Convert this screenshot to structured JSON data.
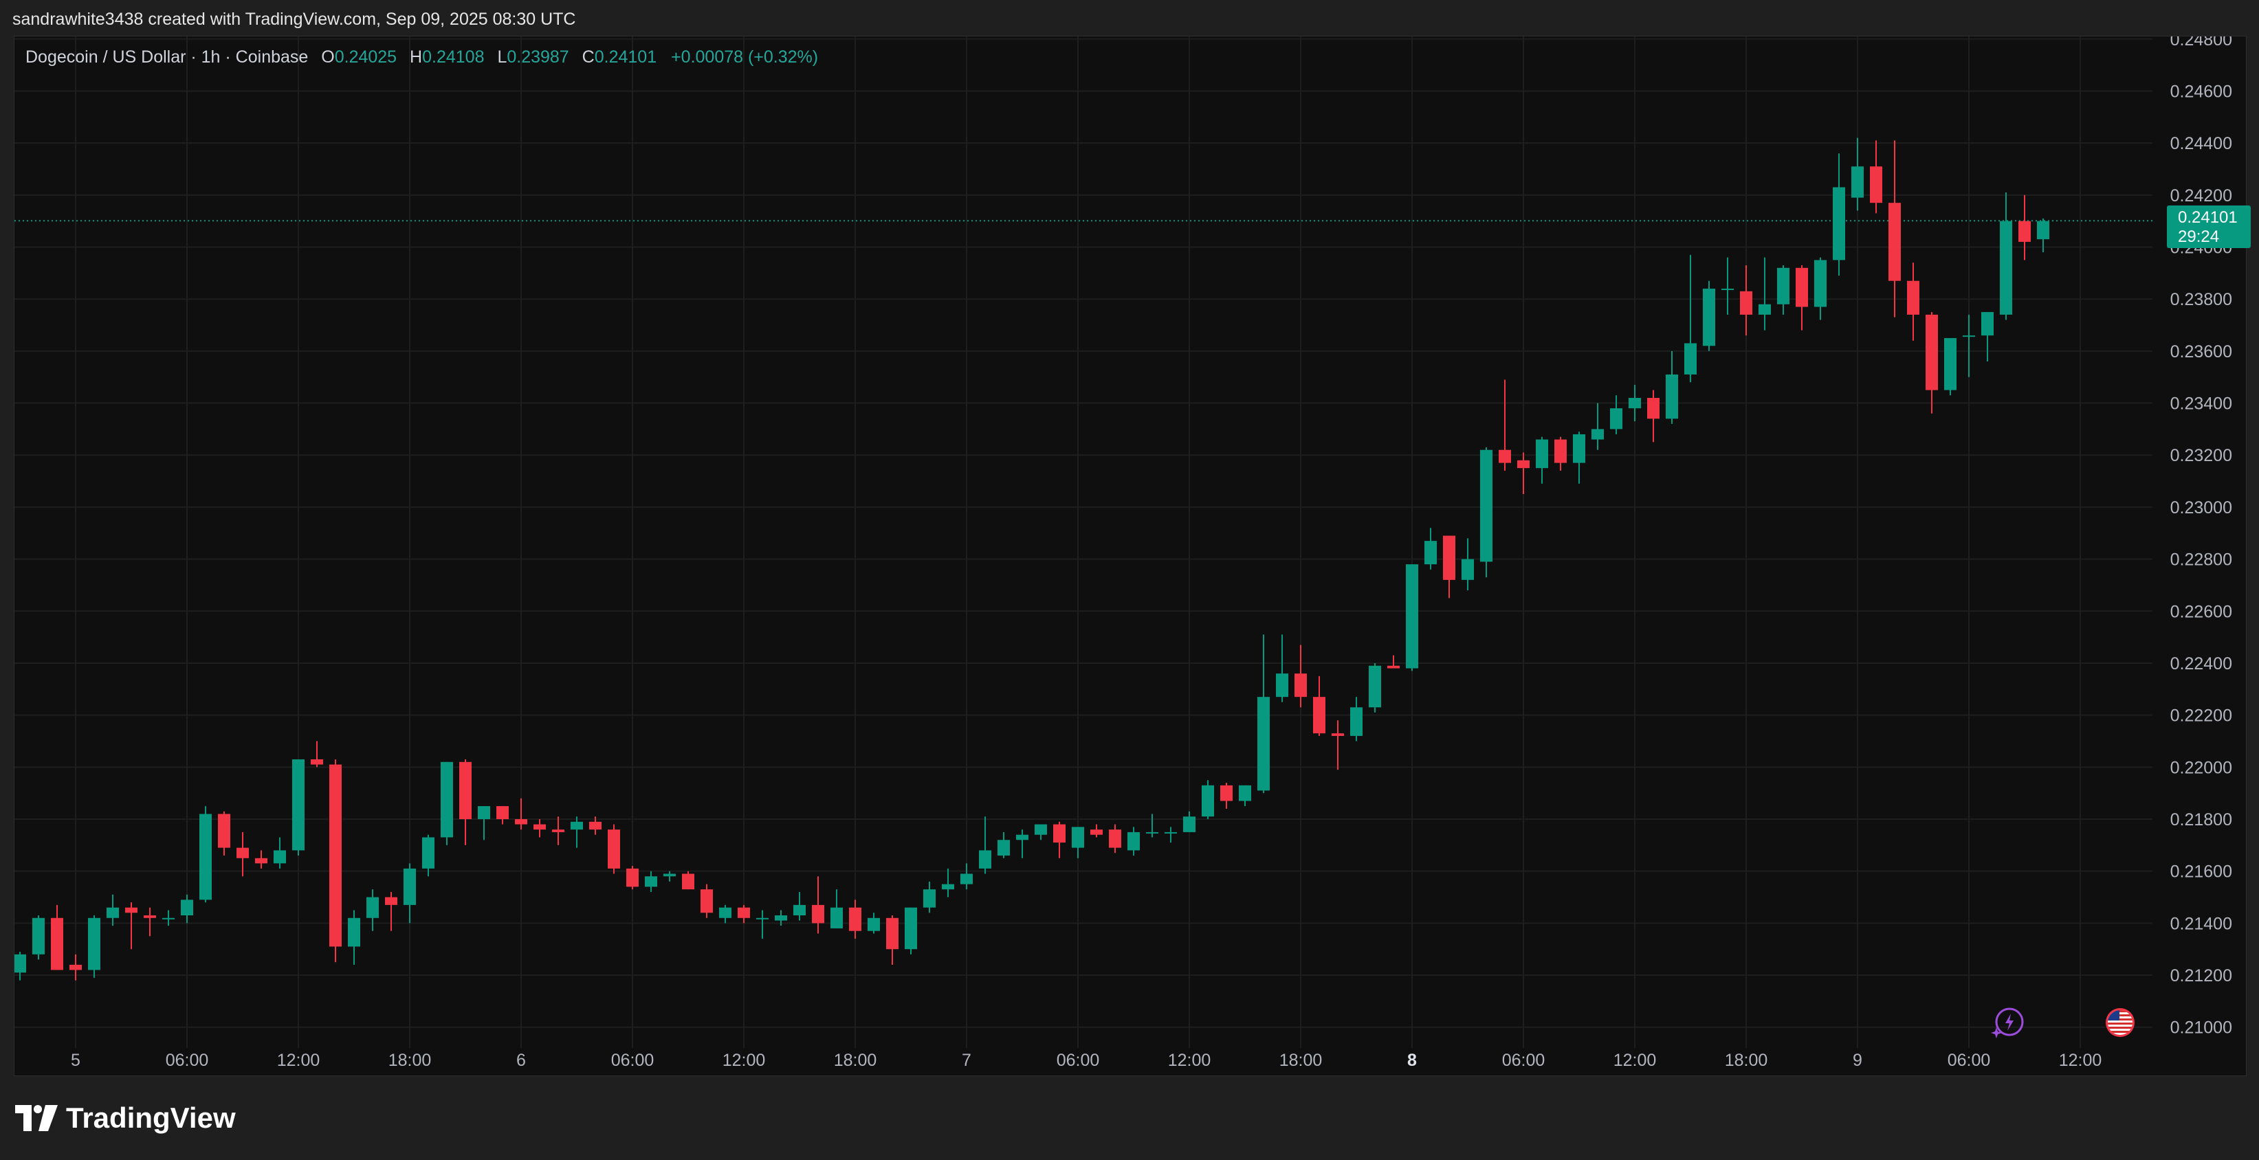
{
  "credit": "sandrawhite3438 created with TradingView.com, Sep 09, 2025 08:30 UTC",
  "legend": {
    "symbol": "Dogecoin / US Dollar · 1h · Coinbase",
    "o_label": "O",
    "o_value": "0.24025",
    "h_label": "H",
    "h_value": "0.24108",
    "l_label": "L",
    "l_value": "0.23987",
    "c_label": "C",
    "c_value": "0.24101",
    "change": "+0.00078 (+0.32%)"
  },
  "price_tag": {
    "price": "0.24101",
    "countdown": "29:24"
  },
  "logo_text": "TradingView",
  "colors": {
    "up": "#089981",
    "down": "#f23645",
    "background": "#0f0f0f",
    "grid": "#1e1e1e"
  },
  "icons": [
    "lightning-icon",
    "us-flag-icon",
    "tradingview-logo-icon"
  ],
  "chart_data": {
    "type": "candlestick",
    "title": "",
    "xlabel": "",
    "ylabel": "",
    "ylim": [
      0.2092,
      0.2481
    ],
    "y_ticks": [
      "0.21000",
      "0.21200",
      "0.21400",
      "0.21600",
      "0.21800",
      "0.22000",
      "0.22200",
      "0.22400",
      "0.22600",
      "0.22800",
      "0.23000",
      "0.23200",
      "0.23400",
      "0.23600",
      "0.23800",
      "0.24000",
      "0.24200",
      "0.24400",
      "0.24600",
      "0.24800"
    ],
    "x_ticks": [
      {
        "index": 3,
        "label": "5",
        "bold": false
      },
      {
        "index": 9,
        "label": "06:00",
        "bold": false
      },
      {
        "index": 15,
        "label": "12:00",
        "bold": false
      },
      {
        "index": 21,
        "label": "18:00",
        "bold": false
      },
      {
        "index": 27,
        "label": "6",
        "bold": false
      },
      {
        "index": 33,
        "label": "06:00",
        "bold": false
      },
      {
        "index": 39,
        "label": "12:00",
        "bold": false
      },
      {
        "index": 45,
        "label": "18:00",
        "bold": false
      },
      {
        "index": 51,
        "label": "7",
        "bold": false
      },
      {
        "index": 57,
        "label": "06:00",
        "bold": false
      },
      {
        "index": 63,
        "label": "12:00",
        "bold": false
      },
      {
        "index": 69,
        "label": "18:00",
        "bold": false
      },
      {
        "index": 75,
        "label": "8",
        "bold": true
      },
      {
        "index": 81,
        "label": "06:00",
        "bold": false
      },
      {
        "index": 87,
        "label": "12:00",
        "bold": false
      },
      {
        "index": 93,
        "label": "18:00",
        "bold": false
      },
      {
        "index": 99,
        "label": "9",
        "bold": false
      },
      {
        "index": 105,
        "label": "06:00",
        "bold": false
      },
      {
        "index": 111,
        "label": "12:00",
        "bold": false
      }
    ],
    "last_price": 0.24101,
    "candles": [
      [
        0.2121,
        0.2129,
        0.2118,
        0.2128
      ],
      [
        0.2128,
        0.2143,
        0.2126,
        0.2142
      ],
      [
        0.2142,
        0.2147,
        0.2122,
        0.2122
      ],
      [
        0.2124,
        0.2128,
        0.2118,
        0.2122
      ],
      [
        0.2122,
        0.2143,
        0.2119,
        0.2142
      ],
      [
        0.2142,
        0.2151,
        0.2139,
        0.2146
      ],
      [
        0.2146,
        0.2148,
        0.213,
        0.2144
      ],
      [
        0.2143,
        0.2146,
        0.2135,
        0.2142
      ],
      [
        0.2142,
        0.2145,
        0.2139,
        0.2142
      ],
      [
        0.2143,
        0.2151,
        0.214,
        0.2149
      ],
      [
        0.2149,
        0.2185,
        0.2148,
        0.2182
      ],
      [
        0.2182,
        0.2183,
        0.2166,
        0.2169
      ],
      [
        0.2169,
        0.2175,
        0.2158,
        0.2165
      ],
      [
        0.2165,
        0.2168,
        0.2161,
        0.2163
      ],
      [
        0.2163,
        0.2173,
        0.2161,
        0.2168
      ],
      [
        0.2168,
        0.2203,
        0.2166,
        0.2203
      ],
      [
        0.2203,
        0.221,
        0.22,
        0.2201
      ],
      [
        0.2201,
        0.2203,
        0.2125,
        0.2131
      ],
      [
        0.2131,
        0.2145,
        0.2124,
        0.2142
      ],
      [
        0.2142,
        0.2153,
        0.2137,
        0.215
      ],
      [
        0.215,
        0.2152,
        0.2137,
        0.2147
      ],
      [
        0.2147,
        0.2163,
        0.214,
        0.2161
      ],
      [
        0.2161,
        0.2174,
        0.2158,
        0.2173
      ],
      [
        0.2173,
        0.2202,
        0.217,
        0.2202
      ],
      [
        0.2202,
        0.2203,
        0.217,
        0.218
      ],
      [
        0.218,
        0.2185,
        0.2172,
        0.2185
      ],
      [
        0.2185,
        0.2185,
        0.2178,
        0.218
      ],
      [
        0.218,
        0.2188,
        0.2176,
        0.2178
      ],
      [
        0.2178,
        0.218,
        0.2173,
        0.2176
      ],
      [
        0.2176,
        0.2181,
        0.217,
        0.2175
      ],
      [
        0.2176,
        0.2181,
        0.2169,
        0.2179
      ],
      [
        0.2179,
        0.2181,
        0.2174,
        0.2176
      ],
      [
        0.2176,
        0.2178,
        0.2159,
        0.2161
      ],
      [
        0.2161,
        0.2162,
        0.2153,
        0.2154
      ],
      [
        0.2154,
        0.216,
        0.2152,
        0.2158
      ],
      [
        0.2158,
        0.216,
        0.2156,
        0.2159
      ],
      [
        0.2159,
        0.216,
        0.2153,
        0.2153
      ],
      [
        0.2153,
        0.2155,
        0.2142,
        0.2144
      ],
      [
        0.2142,
        0.2147,
        0.214,
        0.2146
      ],
      [
        0.2146,
        0.2147,
        0.214,
        0.2142
      ],
      [
        0.2142,
        0.2145,
        0.2134,
        0.2142
      ],
      [
        0.2141,
        0.2145,
        0.2139,
        0.2143
      ],
      [
        0.2143,
        0.2152,
        0.2141,
        0.2147
      ],
      [
        0.2147,
        0.2158,
        0.2136,
        0.214
      ],
      [
        0.2138,
        0.2153,
        0.2138,
        0.2146
      ],
      [
        0.2146,
        0.2149,
        0.2134,
        0.2137
      ],
      [
        0.2137,
        0.2144,
        0.2136,
        0.2142
      ],
      [
        0.2142,
        0.2143,
        0.2124,
        0.213
      ],
      [
        0.213,
        0.2146,
        0.2128,
        0.2146
      ],
      [
        0.2146,
        0.2156,
        0.2144,
        0.2153
      ],
      [
        0.2153,
        0.2161,
        0.215,
        0.2155
      ],
      [
        0.2155,
        0.2163,
        0.2153,
        0.2159
      ],
      [
        0.2161,
        0.2181,
        0.2159,
        0.2168
      ],
      [
        0.2166,
        0.2175,
        0.2165,
        0.2172
      ],
      [
        0.2172,
        0.2176,
        0.2165,
        0.2174
      ],
      [
        0.2174,
        0.2178,
        0.2172,
        0.2178
      ],
      [
        0.2178,
        0.2179,
        0.2165,
        0.2171
      ],
      [
        0.2169,
        0.2175,
        0.2165,
        0.2177
      ],
      [
        0.2176,
        0.2178,
        0.2173,
        0.2174
      ],
      [
        0.2176,
        0.2178,
        0.2167,
        0.2169
      ],
      [
        0.2168,
        0.2177,
        0.2166,
        0.2175
      ],
      [
        0.2175,
        0.2182,
        0.2173,
        0.2175
      ],
      [
        0.2175,
        0.2177,
        0.2171,
        0.2175
      ],
      [
        0.2175,
        0.2183,
        0.2175,
        0.2181
      ],
      [
        0.2181,
        0.2195,
        0.218,
        0.2193
      ],
      [
        0.2193,
        0.2194,
        0.2184,
        0.2187
      ],
      [
        0.2187,
        0.2193,
        0.2185,
        0.2193
      ],
      [
        0.2191,
        0.2251,
        0.219,
        0.2227
      ],
      [
        0.2227,
        0.2251,
        0.2225,
        0.2236
      ],
      [
        0.2236,
        0.2247,
        0.2223,
        0.2227
      ],
      [
        0.2227,
        0.2235,
        0.2212,
        0.2213
      ],
      [
        0.2213,
        0.2218,
        0.2199,
        0.2212
      ],
      [
        0.2212,
        0.2227,
        0.221,
        0.2223
      ],
      [
        0.2223,
        0.224,
        0.2221,
        0.2239
      ],
      [
        0.2239,
        0.2243,
        0.2238,
        0.2238
      ],
      [
        0.2238,
        0.2278,
        0.2237,
        0.2278
      ],
      [
        0.2278,
        0.2292,
        0.2276,
        0.2287
      ],
      [
        0.2289,
        0.2289,
        0.2265,
        0.2272
      ],
      [
        0.2272,
        0.2288,
        0.2268,
        0.228
      ],
      [
        0.2279,
        0.2323,
        0.2273,
        0.2322
      ],
      [
        0.2322,
        0.2349,
        0.2314,
        0.2317
      ],
      [
        0.2318,
        0.2321,
        0.2305,
        0.2315
      ],
      [
        0.2315,
        0.2327,
        0.2309,
        0.2326
      ],
      [
        0.2326,
        0.2327,
        0.2314,
        0.2317
      ],
      [
        0.2317,
        0.2329,
        0.2309,
        0.2328
      ],
      [
        0.2326,
        0.234,
        0.2322,
        0.233
      ],
      [
        0.233,
        0.2343,
        0.2328,
        0.2338
      ],
      [
        0.2338,
        0.2347,
        0.2333,
        0.2342
      ],
      [
        0.2342,
        0.2345,
        0.2325,
        0.2334
      ],
      [
        0.2334,
        0.236,
        0.2332,
        0.2351
      ],
      [
        0.2351,
        0.2397,
        0.2348,
        0.2363
      ],
      [
        0.2362,
        0.2387,
        0.236,
        0.2384
      ],
      [
        0.2384,
        0.2396,
        0.2374,
        0.2384
      ],
      [
        0.2383,
        0.2393,
        0.2366,
        0.2374
      ],
      [
        0.2374,
        0.2396,
        0.2368,
        0.2378
      ],
      [
        0.2378,
        0.2393,
        0.2374,
        0.2392
      ],
      [
        0.2392,
        0.2393,
        0.2368,
        0.2377
      ],
      [
        0.2377,
        0.2396,
        0.2372,
        0.2395
      ],
      [
        0.2395,
        0.2436,
        0.2389,
        0.2423
      ],
      [
        0.2419,
        0.2442,
        0.2414,
        0.2431
      ],
      [
        0.2431,
        0.2441,
        0.2413,
        0.2417
      ],
      [
        0.2417,
        0.2441,
        0.2373,
        0.2387
      ],
      [
        0.2387,
        0.2394,
        0.2364,
        0.2374
      ],
      [
        0.2374,
        0.2375,
        0.2336,
        0.2345
      ],
      [
        0.2345,
        0.2365,
        0.2343,
        0.2365
      ],
      [
        0.2366,
        0.2374,
        0.235,
        0.2366
      ],
      [
        0.2366,
        0.2375,
        0.2356,
        0.2375
      ],
      [
        0.2374,
        0.2421,
        0.2372,
        0.241
      ],
      [
        0.241,
        0.242,
        0.2395,
        0.2402
      ],
      [
        0.2403,
        0.2411,
        0.2398,
        0.241
      ]
    ]
  }
}
